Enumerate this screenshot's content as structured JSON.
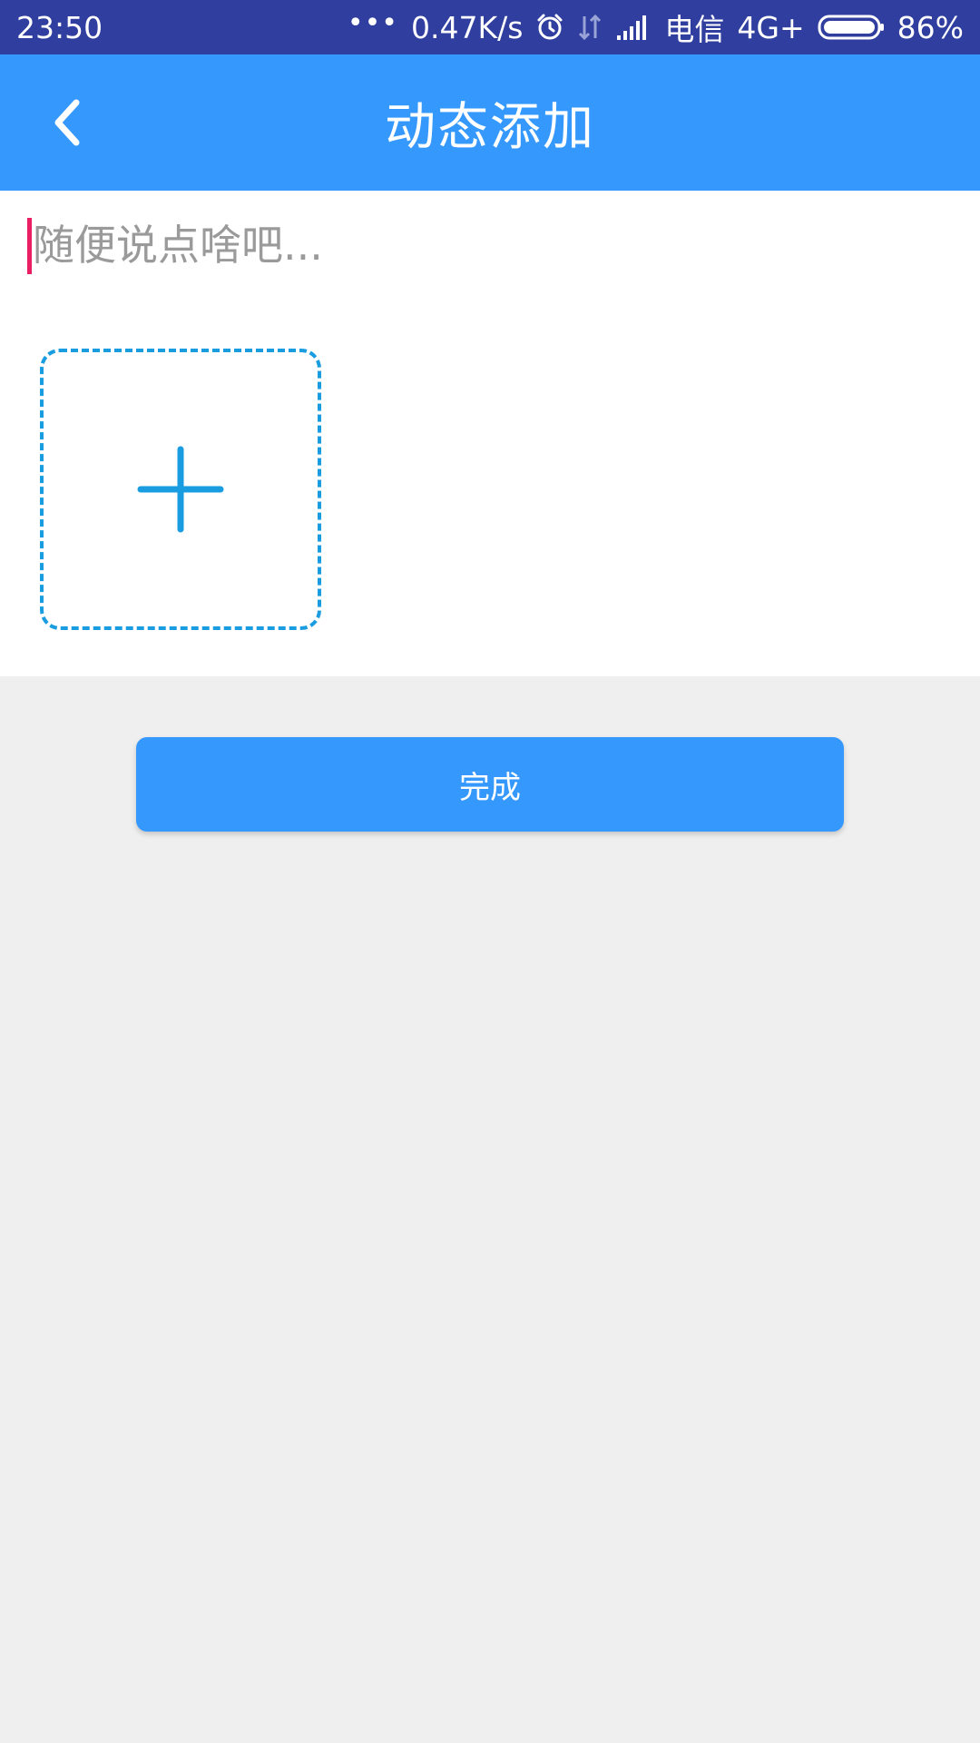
{
  "status_bar": {
    "time": "23:50",
    "dots": "•••",
    "network_speed": "0.47K/s",
    "carrier": "电信",
    "network_type": "4G+",
    "battery": "86%",
    "icons": [
      "alarm-icon",
      "data-transfer-icon",
      "signal-icon",
      "battery-icon"
    ]
  },
  "header": {
    "title": "动态添加",
    "back_icon": "chevron-left-icon"
  },
  "post": {
    "placeholder": "随便说点啥吧...",
    "value": "",
    "add_image_icon": "plus-icon"
  },
  "actions": {
    "done_label": "完成"
  },
  "colors": {
    "status_bar": "#303f9f",
    "primary": "#3598fd",
    "dashed_border": "#1a9ce0",
    "caret": "#e91e63",
    "background": "#efefef"
  }
}
